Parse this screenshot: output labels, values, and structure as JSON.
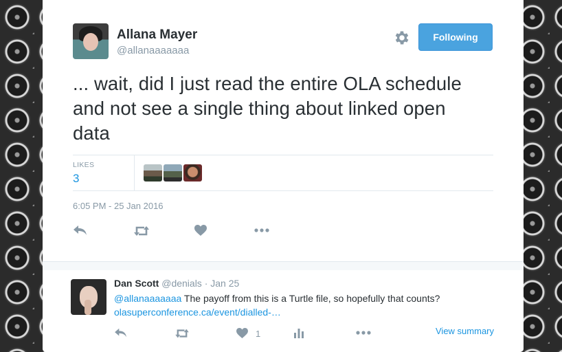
{
  "tweet": {
    "author_name": "Allana Mayer",
    "author_handle": "@allanaaaaaaa",
    "follow_label": "Following",
    "text": "... wait, did I just read the entire OLA schedule and not see a single thing about linked open data",
    "likes_label": "LIKES",
    "likes_count": "3",
    "timestamp": "6:05 PM - 25 Jan 2016",
    "icons": [
      "gear-icon",
      "reply-icon",
      "retweet-icon",
      "heart-icon",
      "more-icon"
    ]
  },
  "reply": {
    "author_name": "Dan Scott",
    "meta": "@denials · Jan 25",
    "mention": "@allanaaaaaaa",
    "text": " The payoff from this is a Turtle file, so hopefully that counts?",
    "link_text": "olasuperconference.ca/event/dialled-…",
    "like_count": "1",
    "view_summary": "View summary",
    "icons": [
      "reply-icon",
      "retweet-icon",
      "heart-icon",
      "analytics-icon",
      "more-icon"
    ]
  },
  "colors": {
    "accent": "#1b95e0",
    "follow_button": "#4aa3df",
    "muted": "#8899a6",
    "text": "#292f33"
  }
}
